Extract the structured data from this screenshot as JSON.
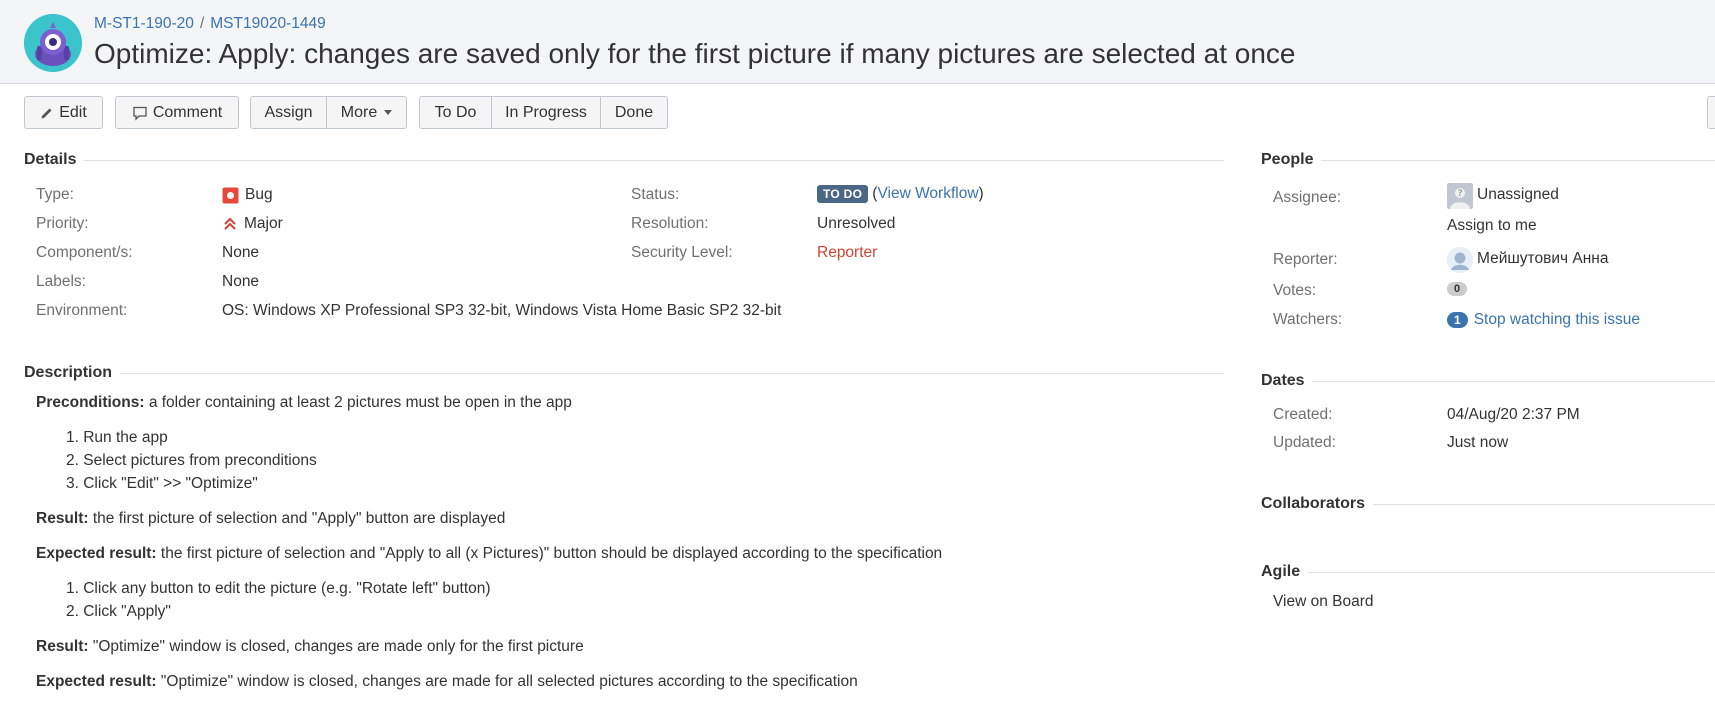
{
  "header": {
    "breadcrumb_project": "M-ST1-190-20",
    "breadcrumb_issue": "MST19020-1449",
    "title": "Optimize: Apply: changes are saved only for the first picture if many pictures are selected at once"
  },
  "toolbar": {
    "edit": "Edit",
    "comment": "Comment",
    "assign": "Assign",
    "more": "More",
    "todo": "To Do",
    "in_progress": "In Progress",
    "done": "Done"
  },
  "details": {
    "heading": "Details",
    "type_label": "Type:",
    "type_value": "Bug",
    "priority_label": "Priority:",
    "priority_value": "Major",
    "components_label": "Component/s:",
    "components_value": "None",
    "labels_label": "Labels:",
    "labels_value": "None",
    "environment_label": "Environment:",
    "environment_value": "OS: Windows XP Professional SP3 32-bit, Windows Vista Home Basic SP2 32-bit",
    "status_label": "Status:",
    "status_value": "TO DO",
    "status_paren_open": "(",
    "view_workflow": "View Workflow",
    "status_paren_close": ")",
    "resolution_label": "Resolution:",
    "resolution_value": "Unresolved",
    "security_label": "Security Level:",
    "security_value": "Reporter"
  },
  "description": {
    "heading": "Description",
    "preconditions_label": "Preconditions:",
    "preconditions_text": " a folder containing at least 2 pictures must be open in the app",
    "steps1": [
      "1. Run the app",
      "2. Select pictures from preconditions",
      "3. Click \"Edit\" >> \"Optimize\""
    ],
    "result1_label": "Result:",
    "result1_text": " the first picture of selection and \"Apply\" button are displayed",
    "expected1_label": "Expected result:",
    "expected1_text": " the first picture of selection and \"Apply to all (x Pictures)\" button should be displayed according to the specification",
    "steps2": [
      "1. Click any button to edit the picture (e.g. \"Rotate left\" button)",
      "2. Click \"Apply\""
    ],
    "result2_label": "Result:",
    "result2_text": " \"Optimize\" window is closed, changes are made only for the first picture",
    "expected2_label": "Expected result:",
    "expected2_text": " \"Optimize\" window is closed, changes are made for all selected pictures according to the specification"
  },
  "people": {
    "heading": "People",
    "assignee_label": "Assignee:",
    "assignee_value": "Unassigned",
    "assign_to_me": "Assign to me",
    "reporter_label": "Reporter:",
    "reporter_value": "Мейшутович Анна",
    "votes_label": "Votes:",
    "votes_count": "0",
    "watchers_label": "Watchers:",
    "watchers_count": "1",
    "stop_watching": "Stop watching this issue"
  },
  "dates": {
    "heading": "Dates",
    "created_label": "Created:",
    "created_value": "04/Aug/20 2:37 PM",
    "updated_label": "Updated:",
    "updated_value": "Just now"
  },
  "collaborators": {
    "heading": "Collaborators"
  },
  "agile": {
    "heading": "Agile",
    "view_on_board": "View on Board"
  },
  "colors": {
    "link": "#3b73af",
    "bug_red": "#d04437",
    "lozenge": "#4a6785",
    "header_bg": "#f4f5f7"
  }
}
